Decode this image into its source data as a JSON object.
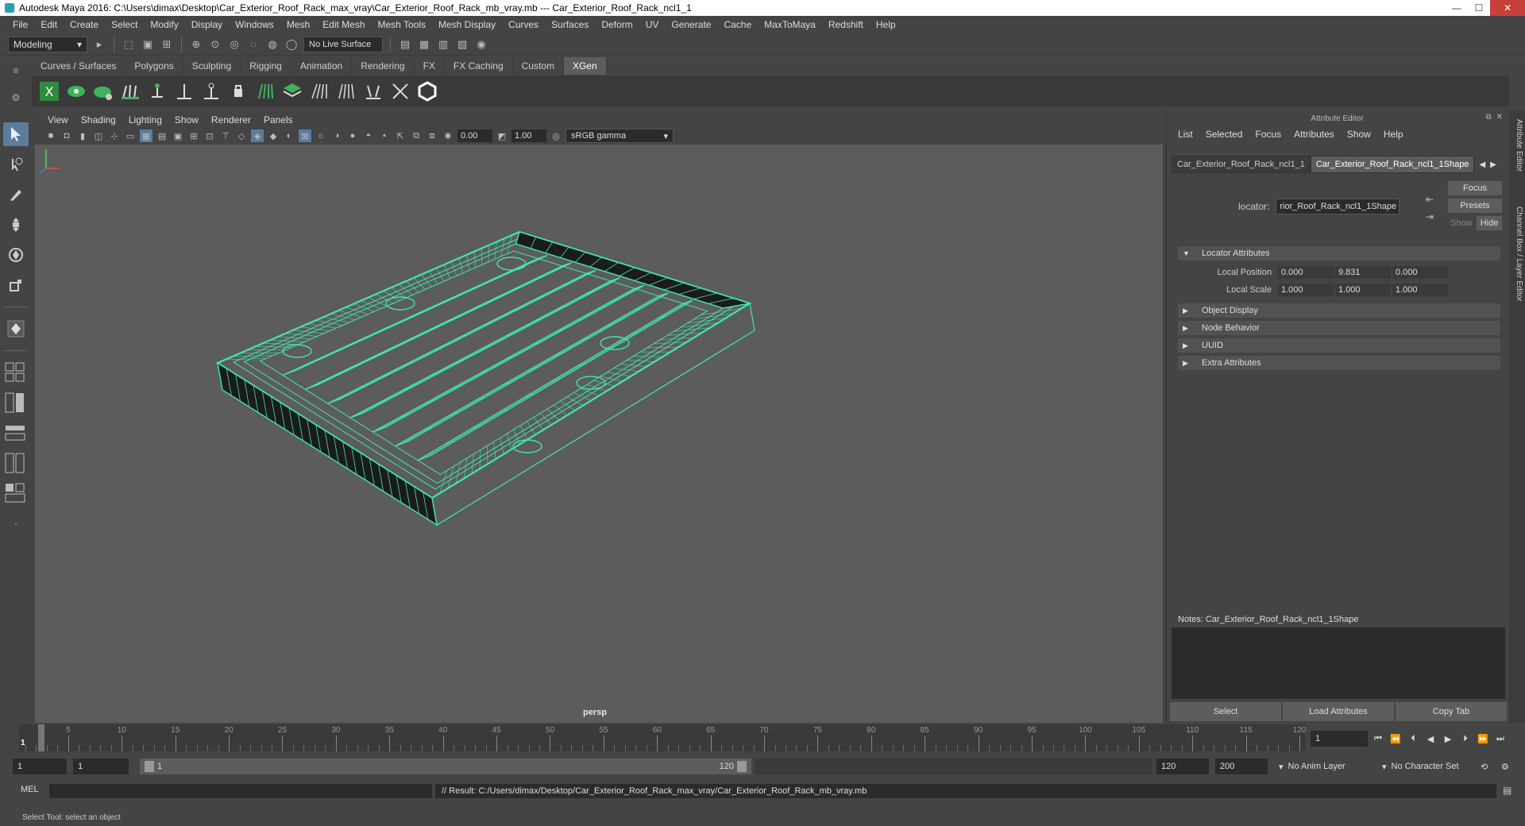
{
  "window": {
    "title": "Autodesk Maya 2016: C:\\Users\\dimax\\Desktop\\Car_Exterior_Roof_Rack_max_vray\\Car_Exterior_Roof_Rack_mb_vray.mb   ---   Car_Exterior_Roof_Rack_ncl1_1",
    "min": "—",
    "max": "☐",
    "close": "✕"
  },
  "menubar": [
    "File",
    "Edit",
    "Create",
    "Select",
    "Modify",
    "Display",
    "Windows",
    "Mesh",
    "Edit Mesh",
    "Mesh Tools",
    "Mesh Display",
    "Curves",
    "Surfaces",
    "Deform",
    "UV",
    "Generate",
    "Cache",
    "MaxToMaya",
    "Redshift",
    "Help"
  ],
  "statusline": {
    "mode": "Modeling",
    "live_surface": "No Live Surface"
  },
  "shelf": {
    "tabs": [
      "Curves / Surfaces",
      "Polygons",
      "Sculpting",
      "Rigging",
      "Animation",
      "Rendering",
      "FX",
      "FX Caching",
      "Custom",
      "XGen"
    ],
    "active_tab": "XGen"
  },
  "viewport": {
    "menu": [
      "View",
      "Shading",
      "Lighting",
      "Show",
      "Renderer",
      "Panels"
    ],
    "exposure": "0.00",
    "gamma": "1.00",
    "color_space": "sRGB gamma",
    "camera": "persp",
    "wire_color": "#3fe6b0"
  },
  "attribute_editor": {
    "header": "Attribute Editor",
    "menu": [
      "List",
      "Selected",
      "Focus",
      "Attributes",
      "Show",
      "Help"
    ],
    "tabs": [
      "Car_Exterior_Roof_Rack_ncl1_1",
      "Car_Exterior_Roof_Rack_ncl1_1Shape"
    ],
    "locator_label": "locator:",
    "locator_value": "rior_Roof_Rack_ncl1_1Shape",
    "focus_btn": "Focus",
    "presets_btn": "Presets",
    "show_btn": "Show",
    "hide_btn": "Hide",
    "sections": [
      {
        "title": "Locator Attributes",
        "expanded": true,
        "rows": [
          {
            "name": "Local Position",
            "values": [
              "0.000",
              "9.831",
              "0.000"
            ]
          },
          {
            "name": "Local Scale",
            "values": [
              "1.000",
              "1.000",
              "1.000"
            ]
          }
        ]
      },
      {
        "title": "Object Display",
        "expanded": false
      },
      {
        "title": "Node Behavior",
        "expanded": false
      },
      {
        "title": "UUID",
        "expanded": false
      },
      {
        "title": "Extra Attributes",
        "expanded": false
      }
    ],
    "notes_label": "Notes:  Car_Exterior_Roof_Rack_ncl1_1Shape",
    "bottom_buttons": [
      "Select",
      "Load Attributes",
      "Copy Tab"
    ]
  },
  "right_strip": [
    "Attribute Editor",
    "Channel Box / Layer Editor"
  ],
  "timeline": {
    "ticks": [
      5,
      10,
      15,
      20,
      25,
      30,
      35,
      40,
      45,
      50,
      55,
      60,
      65,
      70,
      75,
      80,
      85,
      90,
      95,
      100,
      105,
      110,
      115,
      120
    ],
    "current_frame_label": "1",
    "current_frame_field": "1"
  },
  "range": {
    "start": "1",
    "playback_start": "1",
    "slider_start": "1",
    "slider_end": "120",
    "playback_end": "120",
    "end": "200",
    "anim_layer": "No Anim Layer",
    "character_set": "No Character Set"
  },
  "command_line": {
    "label": "MEL",
    "result": "// Result: C:/Users/dimax/Desktop/Car_Exterior_Roof_Rack_max_vray/Car_Exterior_Roof_Rack_mb_vray.mb"
  },
  "help_line": "Select Tool: select an object"
}
